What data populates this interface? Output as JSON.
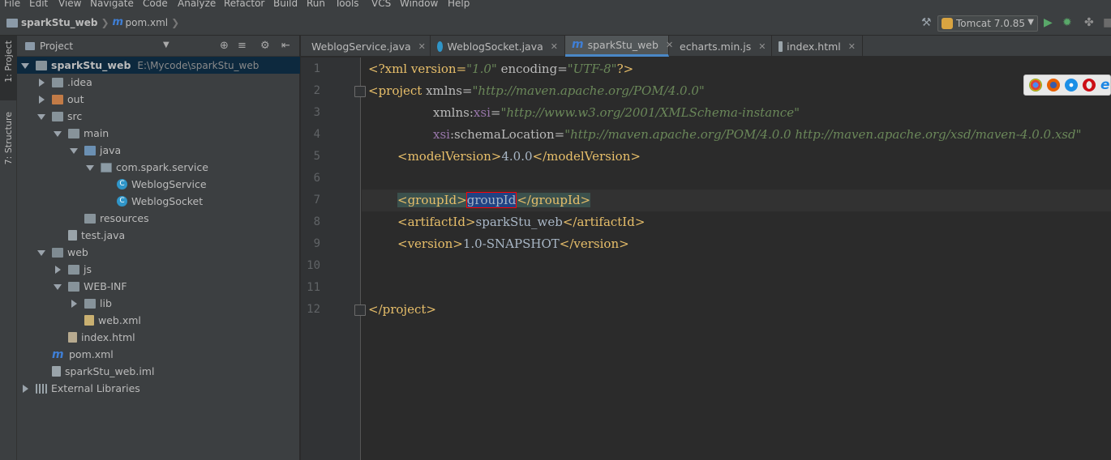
{
  "menu": [
    "File",
    "Edit",
    "View",
    "Navigate",
    "Code",
    "Analyze",
    "Refactor",
    "Build",
    "Run",
    "Tools",
    "VCS",
    "Window",
    "Help"
  ],
  "breadcrumb": {
    "project": "sparkStu_web",
    "file": "pom.xml"
  },
  "run_config": {
    "label": "Tomcat 7.0.85"
  },
  "tool_windows": {
    "project": "1: Project",
    "structure": "7: Structure"
  },
  "project_panel": {
    "title": "Project",
    "tree": [
      {
        "label": "sparkStu_web",
        "path": "E:\\Mycode\\sparkStu_web",
        "depth": 0,
        "arrow": "open",
        "icon": "folder-blue",
        "bold": true,
        "selected": true
      },
      {
        "label": ".idea",
        "depth": 1,
        "arrow": "closed",
        "icon": "folder-blue"
      },
      {
        "label": "out",
        "depth": 1,
        "arrow": "closed",
        "icon": "folder-out"
      },
      {
        "label": "src",
        "depth": 1,
        "arrow": "open",
        "icon": "folder-blue"
      },
      {
        "label": "main",
        "depth": 2,
        "arrow": "open",
        "icon": "folder-blue"
      },
      {
        "label": "java",
        "depth": 3,
        "arrow": "open",
        "icon": "folder-src"
      },
      {
        "label": "com.spark.service",
        "depth": 4,
        "arrow": "open",
        "icon": "pkg"
      },
      {
        "label": "WeblogService",
        "depth": 5,
        "arrow": "none",
        "icon": "cls"
      },
      {
        "label": "WeblogSocket",
        "depth": 5,
        "arrow": "none",
        "icon": "cls"
      },
      {
        "label": "resources",
        "depth": 3,
        "arrow": "none",
        "icon": "folder-blue"
      },
      {
        "label": "test.java",
        "depth": 2,
        "arrow": "none",
        "icon": "file"
      },
      {
        "label": "web",
        "depth": 1,
        "arrow": "open",
        "icon": "folder-web"
      },
      {
        "label": "js",
        "depth": 2,
        "arrow": "closed",
        "icon": "folder-blue"
      },
      {
        "label": "WEB-INF",
        "depth": 2,
        "arrow": "open",
        "icon": "folder-blue"
      },
      {
        "label": "lib",
        "depth": 3,
        "arrow": "closed",
        "icon": "folder-blue"
      },
      {
        "label": "web.xml",
        "depth": 3,
        "arrow": "none",
        "icon": "xml"
      },
      {
        "label": "index.html",
        "depth": 2,
        "arrow": "none",
        "icon": "html"
      },
      {
        "label": "pom.xml",
        "depth": 1,
        "arrow": "none",
        "icon": "maven"
      },
      {
        "label": "sparkStu_web.iml",
        "depth": 1,
        "arrow": "none",
        "icon": "iml"
      },
      {
        "label": "External Libraries",
        "depth": 0,
        "arrow": "closed",
        "icon": "lib"
      }
    ]
  },
  "tabs": [
    {
      "label": "WeblogService.java",
      "icon": "class"
    },
    {
      "label": "WeblogSocket.java",
      "icon": "class"
    },
    {
      "label": "sparkStu_web",
      "icon": "maven",
      "active": true
    },
    {
      "label": "echarts.min.js",
      "icon": "js"
    },
    {
      "label": "index.html",
      "icon": "html"
    }
  ],
  "editor": {
    "line_numbers": [
      "1",
      "2",
      "3",
      "4",
      "5",
      "6",
      "7",
      "8",
      "9",
      "10",
      "11",
      "12"
    ],
    "lines": {
      "l1_open": "<?xml version=",
      "l1_v1": "\"1.0\"",
      "l1_mid": " encoding=",
      "l1_v2": "\"UTF-8\"",
      "l1_end": "?>",
      "l2_open": "<project",
      "l2_attr": " xmlns=",
      "l2_val": "\"http://maven.apache.org/POM/4.0.0\"",
      "l3_attr": "xmlns:",
      "l3_ns": "xsi",
      "l3_eq": "=",
      "l3_val": "\"http://www.w3.org/2001/XMLSchema-instance\"",
      "l4_ns": "xsi",
      "l4_attr": ":schemaLocation=",
      "l4_val": "\"http://maven.apache.org/POM/4.0.0 http://maven.apache.org/xsd/maven-4.0.0.xsd\"",
      "l5_open": "<modelVersion>",
      "l5_text": "4.0.0",
      "l5_close": "</modelVersion>",
      "l7_open": "<groupId>",
      "l7_text": "groupId",
      "l7_close": "</groupId>",
      "l8_open": "<artifactId>",
      "l8_text": "sparkStu_web",
      "l8_close": "</artifactId>",
      "l9_open": "<version>",
      "l9_text": "1.0-SNAPSHOT",
      "l9_close": "</version>",
      "l12_close": "</project>"
    }
  },
  "browser_icons": [
    "chrome-icon",
    "firefox-icon",
    "safari-icon",
    "opera-icon",
    "ie-icon"
  ],
  "colors": {
    "background": "#2b2b2b",
    "panel": "#3c3f41",
    "tag": "#e8bf6a",
    "value": "#6a8759",
    "selection": "#214283",
    "accent": "#4a88c7"
  }
}
